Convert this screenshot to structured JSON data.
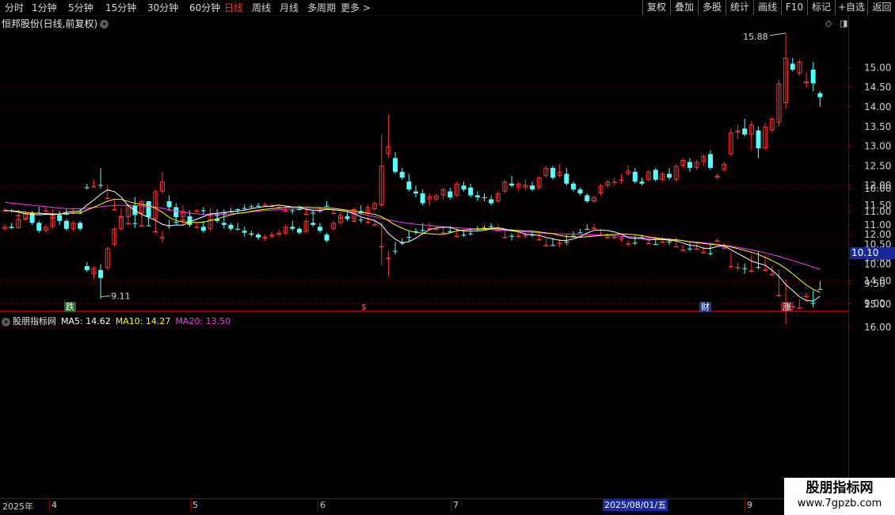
{
  "toolbar": {
    "periods": [
      "分时",
      "1分钟",
      "5分钟",
      "15分钟",
      "30分钟",
      "60分钟",
      "日线",
      "周线",
      "月线",
      "多周期",
      "更多 >"
    ],
    "active_period": "日线",
    "buttons": [
      "复权",
      "叠加",
      "多股",
      "统计",
      "画线",
      "F10",
      "标记",
      "+自选",
      "返回"
    ]
  },
  "main_panel": {
    "title": "恒邦股份(日线,前复权)",
    "high_label": "15.88",
    "low_label": "9.11",
    "price_cursor": "10.10",
    "markers": {
      "down": "跌",
      "s": "$",
      "finance": "财",
      "up": "涨"
    }
  },
  "indicator_panel": {
    "name": "股朋指标网",
    "ma5_label": "MA5: 14.62",
    "ma10_label": "MA10: 14.27",
    "ma20_label": "MA20: 13.50"
  },
  "date_axis": {
    "labels": [
      "2025年",
      "4",
      "5",
      "6",
      "7",
      "9"
    ],
    "highlight": "2025/08/01/五"
  },
  "watermark": {
    "line1": "股朋指标网",
    "line2": "www.7gpzb.com"
  },
  "colors": {
    "up": "#ff3232",
    "down": "#54ffff",
    "ma5": "#ffffff",
    "ma10": "#ffff00",
    "ma20": "#ff33ff",
    "grid": "#8a0000"
  },
  "chart_data": {
    "type": "candlestick",
    "main_y_ticks": [
      "15.00",
      "14.50",
      "14.00",
      "13.50",
      "13.00",
      "12.50",
      "12.00",
      "11.50",
      "11.00",
      "10.50",
      "10.00",
      "9.50",
      "9.00"
    ],
    "sub_y_ticks": [
      "16.00",
      "15.00",
      "14.00",
      "13.00",
      "12.00",
      "11.00",
      "10.00"
    ],
    "ohlc": [
      [
        10.9,
        11.0,
        10.85,
        10.95
      ],
      [
        10.95,
        11.05,
        10.9,
        10.92
      ],
      [
        10.92,
        11.2,
        10.9,
        11.15
      ],
      [
        11.15,
        11.35,
        11.1,
        11.3
      ],
      [
        11.3,
        11.35,
        11.0,
        11.05
      ],
      [
        11.05,
        11.1,
        10.8,
        10.85
      ],
      [
        10.85,
        11.0,
        10.8,
        10.95
      ],
      [
        10.95,
        11.3,
        10.9,
        11.25
      ],
      [
        11.25,
        11.35,
        11.0,
        11.1
      ],
      [
        11.1,
        11.15,
        10.85,
        10.9
      ],
      [
        10.9,
        11.1,
        10.85,
        11.05
      ],
      [
        11.05,
        11.1,
        10.85,
        10.9
      ],
      [
        9.95,
        10.05,
        9.8,
        9.85
      ],
      [
        9.75,
        9.95,
        9.6,
        9.9
      ],
      [
        9.85,
        10.0,
        9.11,
        9.65
      ],
      [
        9.9,
        10.45,
        9.85,
        10.4
      ],
      [
        10.5,
        10.95,
        10.45,
        10.9
      ],
      [
        10.9,
        11.25,
        10.85,
        11.2
      ],
      [
        11.2,
        11.55,
        11.15,
        11.5
      ],
      [
        11.5,
        11.7,
        11.2,
        11.25
      ],
      [
        11.3,
        11.65,
        11.2,
        11.6
      ],
      [
        11.6,
        11.6,
        11.1,
        11.2
      ],
      [
        11.15,
        11.9,
        11.1,
        11.85
      ],
      [
        11.85,
        12.35,
        11.8,
        12.1
      ],
      [
        11.6,
        11.75,
        11.35,
        11.45
      ],
      [
        11.45,
        11.55,
        11.15,
        11.2
      ],
      [
        11.2,
        11.5,
        11.0,
        11.35
      ],
      [
        11.2,
        11.25,
        10.95,
        11.0
      ],
      [
        10.95,
        11.05,
        10.9,
        10.95
      ],
      [
        10.95,
        11.1,
        10.8,
        10.85
      ],
      [
        10.9,
        11.2,
        10.85,
        11.15
      ],
      [
        11.15,
        11.4,
        11.05,
        11.1
      ],
      [
        11.05,
        11.25,
        10.9,
        11.0
      ],
      [
        11.0,
        11.05,
        10.85,
        10.9
      ],
      [
        10.9,
        11.05,
        10.85,
        10.88
      ],
      [
        10.85,
        10.95,
        10.7,
        10.8
      ],
      [
        10.78,
        10.85,
        10.7,
        10.75
      ],
      [
        10.75,
        10.8,
        10.62,
        10.68
      ],
      [
        10.65,
        10.75,
        10.6,
        10.7
      ],
      [
        10.7,
        10.82,
        10.65,
        10.75
      ],
      [
        10.75,
        10.88,
        10.7,
        10.8
      ],
      [
        10.78,
        11.0,
        10.75,
        10.95
      ],
      [
        10.95,
        11.1,
        10.85,
        10.9
      ],
      [
        10.9,
        10.95,
        10.75,
        10.8
      ],
      [
        10.82,
        11.15,
        10.8,
        11.1
      ],
      [
        11.05,
        11.2,
        10.95,
        11.0
      ],
      [
        10.95,
        11.05,
        10.8,
        10.85
      ],
      [
        10.75,
        10.8,
        10.55,
        10.6
      ],
      [
        10.9,
        11.1,
        10.85,
        11.05
      ],
      [
        11.05,
        11.3,
        11.0,
        11.25
      ],
      [
        11.2,
        11.35,
        11.1,
        11.15
      ],
      [
        11.15,
        11.45,
        11.1,
        11.4
      ],
      [
        11.35,
        11.5,
        11.25,
        11.3
      ],
      [
        11.3,
        11.5,
        11.25,
        11.45
      ],
      [
        11.4,
        11.6,
        11.35,
        11.55
      ],
      [
        11.5,
        13.3,
        11.45,
        12.5
      ],
      [
        12.8,
        13.8,
        12.7,
        13.0
      ],
      [
        12.7,
        12.85,
        12.3,
        12.35
      ],
      [
        12.35,
        12.45,
        12.15,
        12.2
      ],
      [
        12.1,
        12.3,
        11.85,
        11.9
      ],
      [
        11.85,
        12.0,
        11.7,
        11.8
      ],
      [
        11.8,
        11.9,
        11.5,
        11.55
      ],
      [
        11.65,
        11.8,
        11.5,
        11.72
      ],
      [
        11.65,
        11.8,
        11.6,
        11.75
      ],
      [
        11.75,
        11.95,
        11.65,
        11.9
      ],
      [
        11.85,
        11.95,
        11.65,
        11.7
      ],
      [
        11.75,
        12.1,
        11.7,
        12.05
      ],
      [
        12.0,
        12.1,
        11.85,
        11.9
      ],
      [
        11.95,
        12.05,
        11.7,
        11.75
      ],
      [
        11.75,
        11.85,
        11.62,
        11.7
      ],
      [
        11.7,
        11.8,
        11.6,
        11.68
      ],
      [
        11.65,
        11.75,
        11.5,
        11.55
      ],
      [
        11.6,
        11.85,
        11.55,
        11.8
      ],
      [
        11.85,
        12.15,
        11.8,
        12.1
      ],
      [
        12.05,
        12.25,
        11.95,
        12.0
      ],
      [
        11.95,
        12.1,
        11.85,
        12.05
      ],
      [
        11.95,
        12.15,
        11.9,
        12.02
      ],
      [
        12.0,
        12.1,
        11.85,
        11.9
      ],
      [
        11.95,
        12.25,
        11.9,
        12.2
      ],
      [
        12.25,
        12.5,
        12.2,
        12.45
      ],
      [
        12.45,
        12.5,
        12.15,
        12.2
      ],
      [
        12.25,
        12.55,
        12.2,
        12.35
      ],
      [
        12.3,
        12.45,
        12.0,
        12.05
      ],
      [
        12.05,
        12.1,
        11.85,
        11.9
      ],
      [
        11.9,
        11.95,
        11.75,
        11.8
      ],
      [
        11.75,
        11.8,
        11.55,
        11.6
      ],
      [
        11.6,
        11.75,
        11.55,
        11.7
      ],
      [
        11.8,
        12.05,
        11.75,
        12.0
      ],
      [
        12.0,
        12.15,
        11.95,
        12.1
      ],
      [
        12.1,
        12.2,
        12.0,
        12.1
      ],
      [
        12.15,
        12.3,
        12.05,
        12.15
      ],
      [
        12.3,
        12.5,
        12.25,
        12.38
      ],
      [
        12.35,
        12.45,
        12.05,
        12.1
      ],
      [
        12.1,
        12.2,
        12.0,
        12.05
      ],
      [
        12.15,
        12.4,
        12.1,
        12.35
      ],
      [
        12.4,
        12.45,
        12.1,
        12.15
      ],
      [
        12.15,
        12.35,
        12.1,
        12.3
      ],
      [
        12.3,
        12.45,
        12.15,
        12.2
      ],
      [
        12.15,
        12.55,
        12.1,
        12.5
      ],
      [
        12.5,
        12.7,
        12.45,
        12.65
      ],
      [
        12.6,
        12.7,
        12.35,
        12.45
      ],
      [
        12.45,
        12.65,
        12.4,
        12.6
      ],
      [
        12.6,
        12.8,
        12.5,
        12.75
      ],
      [
        12.8,
        12.9,
        12.4,
        12.45
      ],
      [
        12.2,
        12.3,
        12.15,
        12.25
      ],
      [
        12.4,
        12.6,
        12.35,
        12.55
      ],
      [
        12.8,
        13.45,
        12.75,
        13.35
      ],
      [
        13.35,
        13.55,
        13.2,
        13.4
      ],
      [
        13.45,
        13.7,
        13.25,
        13.3
      ],
      [
        13.3,
        13.65,
        12.9,
        13.55
      ],
      [
        13.4,
        13.5,
        12.7,
        12.95
      ],
      [
        12.95,
        13.6,
        12.9,
        13.5
      ],
      [
        13.4,
        13.75,
        13.35,
        13.7
      ],
      [
        13.6,
        14.7,
        13.5,
        14.6
      ],
      [
        14.1,
        15.88,
        13.95,
        15.25
      ],
      [
        15.1,
        15.25,
        14.9,
        14.95
      ],
      [
        14.85,
        15.2,
        14.8,
        15.15
      ],
      [
        14.6,
        14.9,
        14.5,
        14.65
      ],
      [
        14.95,
        15.15,
        14.4,
        14.6
      ],
      [
        14.35,
        14.4,
        14.0,
        14.25
      ]
    ],
    "ma5": [
      10.95,
      10.98,
      11.02,
      11.1,
      11.12,
      11.14,
      11.12,
      11.13,
      11.12,
      11.03,
      11.0,
      10.98,
      10.72,
      10.5,
      10.25,
      10.06,
      10.14,
      10.38,
      10.74,
      10.96,
      11.12,
      11.25,
      11.38,
      11.55,
      11.62,
      11.58,
      11.59,
      11.44,
      11.34,
      11.22,
      11.1,
      11.08,
      11.04,
      11.0,
      10.98,
      10.94,
      10.88,
      10.82,
      10.78,
      10.76,
      10.72,
      10.76,
      10.8,
      10.82,
      10.9,
      10.96,
      10.96,
      10.9,
      10.92,
      10.95,
      11.0,
      11.1,
      11.23,
      11.31,
      11.39,
      11.58,
      11.95,
      12.2,
      12.35,
      12.3,
      12.15,
      11.96,
      11.78,
      11.71,
      11.68,
      11.68,
      11.78,
      11.84,
      11.85,
      11.84,
      11.81,
      11.74,
      11.7,
      11.76,
      11.82,
      11.88,
      11.98,
      12.0,
      12.03,
      12.12,
      12.18,
      12.24,
      12.25,
      12.19,
      12.08,
      11.93,
      11.81,
      11.8,
      11.82,
      11.88,
      11.98,
      12.13,
      12.16,
      12.16,
      12.23,
      12.21,
      12.21,
      12.24,
      12.27,
      12.36,
      12.46,
      12.48,
      12.59,
      12.59,
      12.51,
      12.49,
      12.65,
      12.82,
      12.97,
      13.14,
      13.24,
      13.32,
      13.54,
      13.8,
      14.16,
      14.41,
      14.68,
      14.85,
      14.87,
      14.66
    ],
    "ma10": [
      10.95,
      10.97,
      10.99,
      11.03,
      11.06,
      11.08,
      11.09,
      11.1,
      11.11,
      11.09,
      11.07,
      11.05,
      10.93,
      10.81,
      10.68,
      10.55,
      10.47,
      10.48,
      10.56,
      10.64,
      10.68,
      10.74,
      10.85,
      11.03,
      11.25,
      11.39,
      11.45,
      11.46,
      11.47,
      11.46,
      11.39,
      11.31,
      11.23,
      11.14,
      11.08,
      11.04,
      10.99,
      10.94,
      10.9,
      10.87,
      10.85,
      10.82,
      10.81,
      10.8,
      10.81,
      10.82,
      10.84,
      10.85,
      10.86,
      10.9,
      10.94,
      10.98,
      11.02,
      11.08,
      11.12,
      11.22,
      11.39,
      11.58,
      11.72,
      11.84,
      11.9,
      11.93,
      11.96,
      11.98,
      11.99,
      11.91,
      11.84,
      11.79,
      11.77,
      11.75,
      11.74,
      11.74,
      11.75,
      11.78,
      11.8,
      11.82,
      11.84,
      11.85,
      11.88,
      11.92,
      11.96,
      12.03,
      12.08,
      12.1,
      12.11,
      12.09,
      12.06,
      12.03,
      12.0,
      11.99,
      11.97,
      11.98,
      12.0,
      12.04,
      12.1,
      12.14,
      12.17,
      12.2,
      12.22,
      12.26,
      12.31,
      12.35,
      12.38,
      12.41,
      12.44,
      12.47,
      12.53,
      12.6,
      12.68,
      12.76,
      12.86,
      12.98,
      13.12,
      13.27,
      13.46,
      13.69,
      13.94,
      14.18,
      14.36,
      14.5
    ],
    "ma20": [
      10.6,
      10.63,
      10.66,
      10.7,
      10.73,
      10.76,
      10.79,
      10.82,
      10.85,
      10.87,
      10.88,
      10.88,
      10.86,
      10.83,
      10.79,
      10.76,
      10.74,
      10.73,
      10.73,
      10.74,
      10.76,
      10.78,
      10.81,
      10.86,
      10.92,
      10.98,
      11.03,
      11.07,
      11.1,
      11.12,
      11.13,
      11.13,
      11.12,
      11.1,
      11.08,
      11.05,
      11.01,
      10.98,
      10.96,
      10.94,
      10.92,
      10.9,
      10.89,
      10.88,
      10.88,
      10.89,
      10.9,
      10.91,
      10.93,
      10.96,
      11.0,
      11.05,
      11.1,
      11.16,
      11.22,
      11.29,
      11.36,
      11.42,
      11.47,
      11.51,
      11.55,
      11.58,
      11.6,
      11.63,
      11.66,
      11.68,
      11.7,
      11.72,
      11.74,
      11.76,
      11.77,
      11.78,
      11.8,
      11.82,
      11.84,
      11.86,
      11.88,
      11.9,
      11.92,
      11.94,
      11.95,
      11.96,
      11.97,
      11.98,
      11.99,
      12.0,
      12.01,
      12.02,
      12.03,
      12.05,
      12.07,
      12.09,
      12.11,
      12.13,
      12.15,
      12.17,
      12.19,
      12.21,
      12.23,
      12.26,
      12.29,
      12.32,
      12.35,
      12.38,
      12.42,
      12.46,
      12.5,
      12.55,
      12.6,
      12.66,
      12.72,
      12.79,
      12.86,
      12.94,
      13.03,
      13.12,
      13.21,
      13.3,
      13.4,
      13.5
    ]
  }
}
